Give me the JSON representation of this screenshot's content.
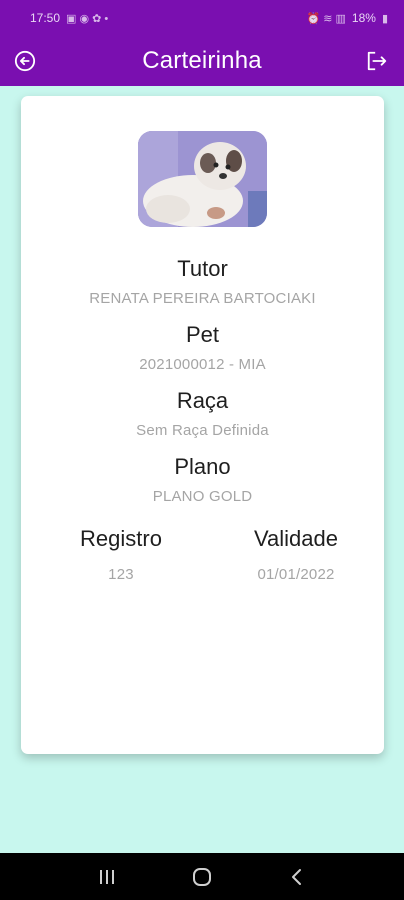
{
  "status_bar": {
    "time": "17:50",
    "battery": "18%"
  },
  "app_bar": {
    "title": "Carteirinha"
  },
  "card": {
    "tutor": {
      "label": "Tutor",
      "value": "RENATA PEREIRA BARTOCIAKI"
    },
    "pet": {
      "label": "Pet",
      "value": "2021000012 - MIA"
    },
    "breed": {
      "label": "Raça",
      "value": "Sem Raça Definida"
    },
    "plan": {
      "label": "Plano",
      "value": "PLANO GOLD"
    },
    "registration": {
      "label": "Registro",
      "value": "123"
    },
    "validity": {
      "label": "Validade",
      "value": "01/01/2022"
    }
  },
  "icons": {
    "back": "back-arrow-circle-icon",
    "logout": "logout-icon",
    "nav_recents": "recents-icon",
    "nav_home": "home-icon",
    "nav_back": "back-chevron-icon"
  },
  "colors": {
    "app_bar": "#7a0fb0",
    "background": "#c8f7ee",
    "card": "#ffffff",
    "label": "#1f1f1f",
    "value": "#a5a5a5"
  }
}
